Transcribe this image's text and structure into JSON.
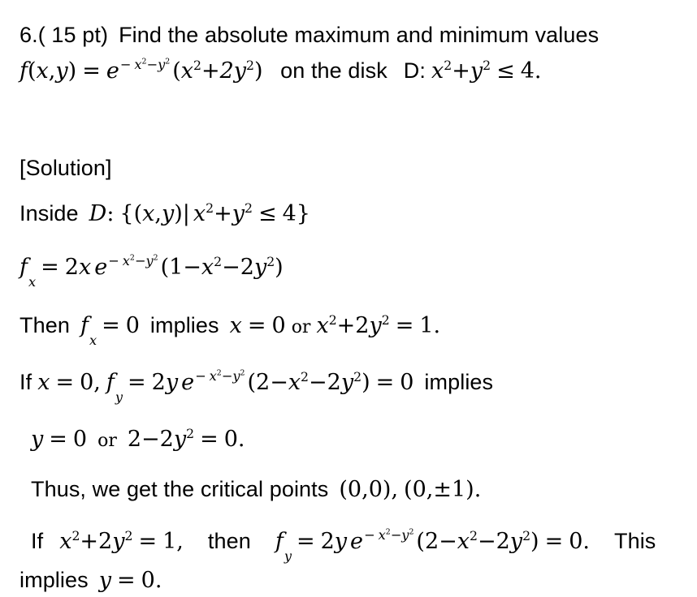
{
  "document": {
    "type": "math-solution",
    "background_color": "#ffffff",
    "text_color": "#000000",
    "problem": {
      "number": "6.",
      "points": "( 15 pt)",
      "statement_line1": "Find the absolute maximum and minimum values",
      "function_label": "f(x,y)",
      "equals": "=",
      "exponential": "e",
      "exponent": "- x² - y²",
      "factor": "(x² + 2y²)",
      "domain_text": "on the disk",
      "domain_label": "D:",
      "domain_condition": "x² + y² ≤ 4."
    },
    "solution": {
      "heading": "[Solution]",
      "inside_label": "Inside",
      "inside_set_label": "D:",
      "inside_set": "{(x,y)| x² + y² ≤ 4}",
      "fx_label": "f",
      "fx_sub": "x",
      "fx_body": "= 2x e^(-x²-y²) (1 - x² - 2y²)",
      "then_word": "Then",
      "then_condition": "f_x = 0",
      "implies_word": "implies",
      "then_result_a": "x = 0",
      "or_word": "or",
      "then_result_b": "x² + 2y² = 1.",
      "if_word": "If",
      "if_condition": "x = 0,",
      "fy_label": "f",
      "fy_sub": "y",
      "fy_body": "= 2y e^(-x²-y²) (2 - x² - 2y²) = 0",
      "implies_word2": "implies",
      "y_result_a": "y = 0",
      "or_word2": "or",
      "y_result_b": "2 - 2y² = 0.",
      "thus_text": "Thus, we get the critical points",
      "critical_points": "(0,0), (0,±1).",
      "if_word2": "If",
      "if_condition2": "x² + 2y² = 1,",
      "then_word2": "then",
      "fy2_label": "f",
      "fy2_sub": "y",
      "fy2_body": "= 2y e^(-x²-y²) (2 - x² - 2y²) = 0.",
      "this_word": "This",
      "implies_word3": "implies",
      "final_result": "y = 0."
    },
    "symbols": {
      "minus": "−",
      "plus": "+",
      "equals": "=",
      "leq": "≤",
      "plusminus": "±",
      "lbrace": "{",
      "rbrace": "}",
      "vbar": "|"
    }
  }
}
